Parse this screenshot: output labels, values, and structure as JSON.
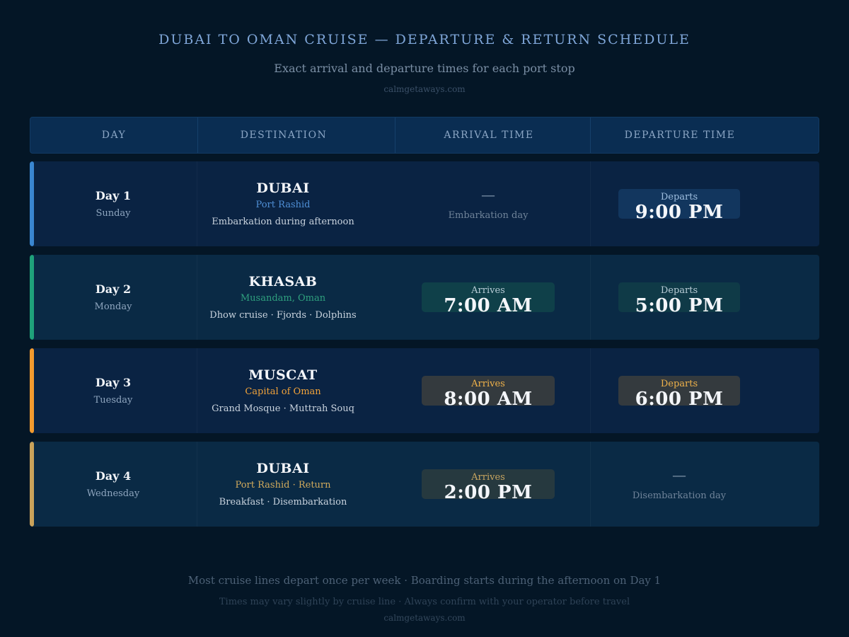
{
  "title": "DUBAI TO OMAN CRUISE — DEPARTURE & RETURN SCHEDULE",
  "subtitle": "Exact arrival and departure times for each port stop",
  "site": "calmgetaways.com",
  "columns": [
    "DAY",
    "DESTINATION",
    "ARRIVAL TIME",
    "DEPARTURE TIME"
  ],
  "rows": [
    {
      "day": "Day 1",
      "weekday": "Sunday",
      "destination": "DUBAI",
      "subtitle": "Port Rashid",
      "note": "Embarkation during afternoon",
      "accent": "#3a86d0",
      "subtitle_color": "#4f8fd6",
      "row_bg": "#0a2343",
      "arrival": {
        "type": "dash",
        "dash": "—",
        "note": "Embarkation day"
      },
      "departure": {
        "type": "pill",
        "label": "Departs",
        "time": "9:00 PM",
        "bg": "#12365e",
        "label_color": "#9fbfe0"
      }
    },
    {
      "day": "Day 2",
      "weekday": "Monday",
      "destination": "KHASAB",
      "subtitle": "Musandam, Oman",
      "note": "Dhow cruise · Fjords · Dolphins",
      "accent": "#1fa17a",
      "subtitle_color": "#2fa07e",
      "row_bg": "#0a2a45",
      "arrival": {
        "type": "pill",
        "label": "Arrives",
        "time": "7:00 AM",
        "bg": "#0f4049",
        "label_color": "#b8ccd6"
      },
      "departure": {
        "type": "pill",
        "label": "Departs",
        "time": "5:00 PM",
        "bg": "#0f3a47",
        "label_color": "#b8ccd6"
      }
    },
    {
      "day": "Day 3",
      "weekday": "Tuesday",
      "destination": "MUSCAT",
      "subtitle": "Capital of Oman",
      "note": "Grand Mosque · Muttrah Souq",
      "accent": "#f29a2e",
      "subtitle_color": "#f0a23a",
      "row_bg": "#0a2343",
      "arrival": {
        "type": "pill",
        "label": "Arrives",
        "time": "8:00 AM",
        "bg": "#343a3e",
        "label_color": "#f0b24a"
      },
      "departure": {
        "type": "pill",
        "label": "Departs",
        "time": "6:00 PM",
        "bg": "#343a3e",
        "label_color": "#f0b24a"
      }
    },
    {
      "day": "Day 4",
      "weekday": "Wednesday",
      "destination": "DUBAI",
      "subtitle": "Port Rashid · Return",
      "note": "Breakfast · Disembarkation",
      "accent": "#c9a25a",
      "subtitle_color": "#d1aa5c",
      "row_bg": "#0a2a45",
      "arrival": {
        "type": "pill",
        "label": "Arrives",
        "time": "2:00 PM",
        "bg": "#26393f",
        "label_color": "#c9a660"
      },
      "departure": {
        "type": "dash",
        "dash": "—",
        "note": "Disembarkation day"
      }
    }
  ],
  "footer_line1": "Most cruise lines depart once per week · Boarding starts during the afternoon on Day 1",
  "footer_line2": "Times may vary slightly by cruise line · Always confirm with your operator before travel",
  "footer_site": "calmgetaways.com"
}
